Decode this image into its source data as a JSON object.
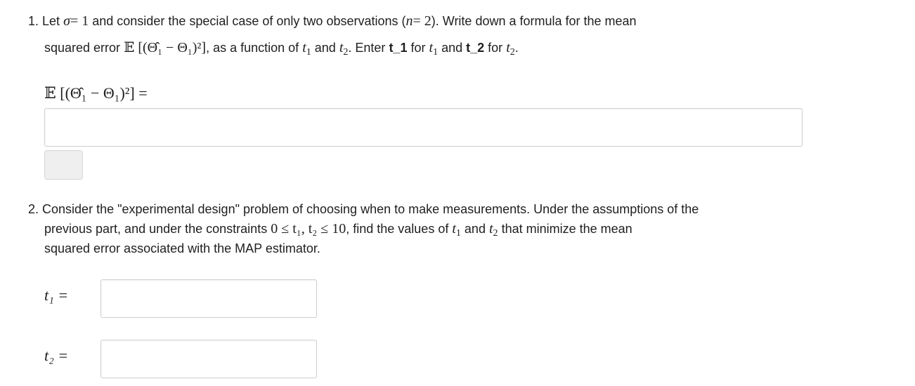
{
  "q1": {
    "number": "1.",
    "line1_a": "Let",
    "sigma": "σ",
    "eq1": "= 1",
    "line1_b": "and consider the special case of only two observations (",
    "n": "n",
    "eq2": "= 2",
    "line1_c": "). Write down a formula for the mean",
    "line2_a": "squared error",
    "expr": "𝔼 [(Θ̂₁ − Θ₁)²]",
    "line2_b": ", as a function of",
    "t1": "t",
    "sub1": "1",
    "and": "and",
    "t2": "t",
    "sub2": "2",
    "line2_c": ". Enter",
    "enter_t1": "t_1",
    "for1": "for",
    "and2": "and",
    "enter_t2": "t_2",
    "for2": "for",
    "period": ".",
    "answer_label_expr": "𝔼 [(Θ̂₁ − Θ₁)²] =",
    "answer_value": ""
  },
  "q2": {
    "number": "2.",
    "line1": "Consider the \"experimental design\" problem of choosing when to make measurements. Under the assumptions of the",
    "line2_a": "previous part, and under the constraints",
    "constraint": "0 ≤ t₁, t₂ ≤ 10",
    "line2_b": ", find the values of",
    "and": "and",
    "line2_c": "that minimize the mean",
    "line3": "squared error associated with the MAP estimator.",
    "t1_label": "t₁ =",
    "t2_label": "t₂ =",
    "t1_value": "",
    "t2_value": ""
  }
}
